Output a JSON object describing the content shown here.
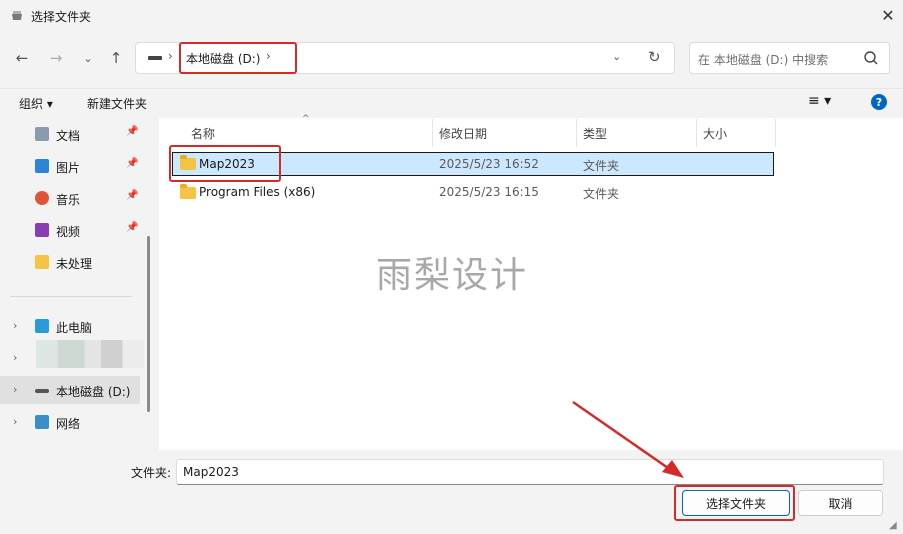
{
  "window": {
    "title": "选择文件夹"
  },
  "address": {
    "crumb": "本地磁盘 (D:)",
    "separator": "›",
    "chevron": "›"
  },
  "search": {
    "placeholder": "在 本地磁盘 (D:) 中搜索"
  },
  "toolbar": {
    "organize": "组织 ▾",
    "new_folder": "新建文件夹",
    "help": "?"
  },
  "sidebar": {
    "quick": [
      {
        "label": "文档",
        "icon": "document-icon"
      },
      {
        "label": "图片",
        "icon": "pictures-icon"
      },
      {
        "label": "音乐",
        "icon": "music-icon"
      },
      {
        "label": "视频",
        "icon": "videos-icon"
      },
      {
        "label": "未处理",
        "icon": "folder-icon"
      }
    ],
    "tree": [
      {
        "label": "此电脑",
        "icon": "this-pc-icon"
      },
      {
        "label": "本地磁盘 (D:)",
        "icon": "drive-icon"
      },
      {
        "label": "网络",
        "icon": "network-icon"
      }
    ]
  },
  "columns": {
    "name": "名称",
    "modified": "修改日期",
    "type": "类型",
    "size": "大小"
  },
  "files": [
    {
      "name": "Map2023",
      "modified": "2025/5/23 16:52",
      "type": "文件夹",
      "size": ""
    },
    {
      "name": "Program Files (x86)",
      "modified": "2025/5/23 16:15",
      "type": "文件夹",
      "size": ""
    }
  ],
  "watermark": "雨梨设计",
  "footer": {
    "folder_label": "文件夹:",
    "folder_value": "Map2023",
    "select_button": "选择文件夹",
    "cancel_button": "取消"
  },
  "colors": {
    "accent": "#0067c0",
    "highlight": "#d42a2a",
    "selection": "#cce8ff"
  }
}
